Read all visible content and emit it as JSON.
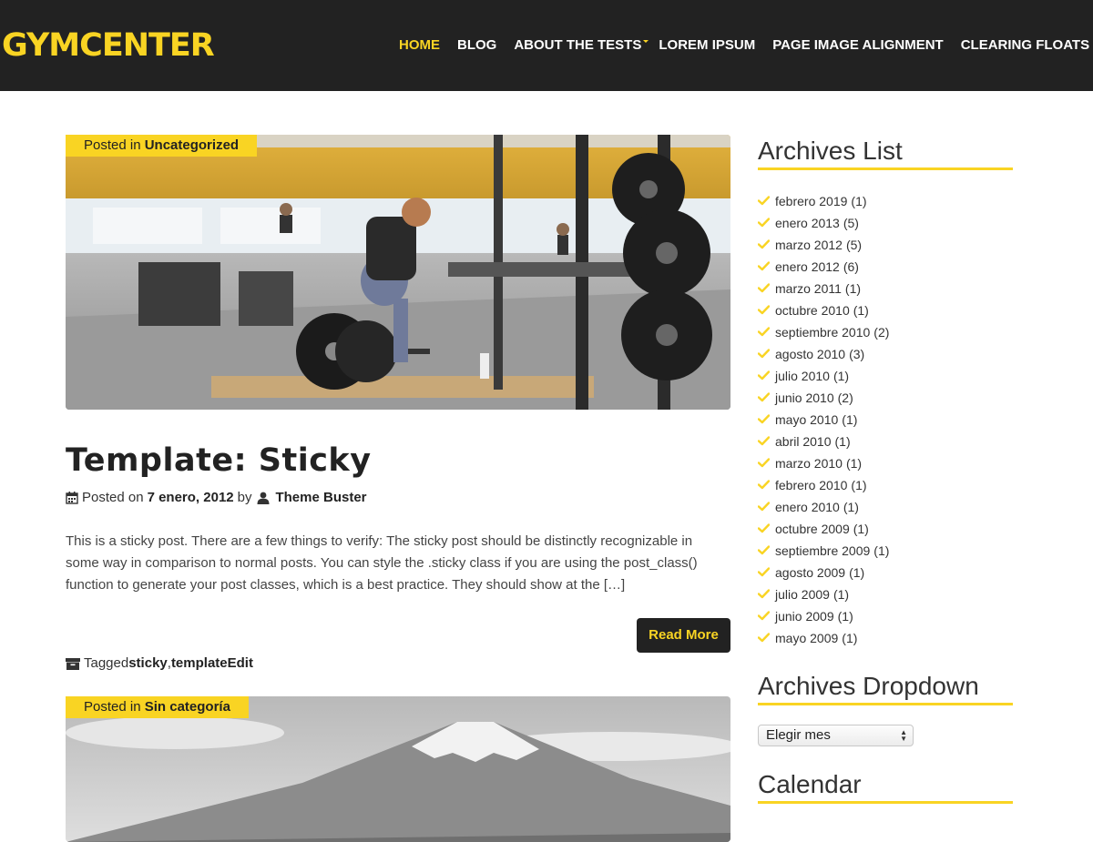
{
  "site": {
    "logo": "GYMCENTER"
  },
  "nav": {
    "items": [
      {
        "label": "HOME"
      },
      {
        "label": "BLOG"
      },
      {
        "label": "ABOUT THE TESTS"
      },
      {
        "label": "LOREM IPSUM"
      },
      {
        "label": "PAGE IMAGE ALIGNMENT"
      },
      {
        "label": "CLEARING FLOATS"
      }
    ]
  },
  "post1": {
    "posted_in_prefix": "Posted in",
    "category": "Uncategorized",
    "title": "Template: Sticky",
    "posted_on_prefix": "Posted on",
    "date": "7 enero, 2012",
    "by": "by",
    "author": "Theme Buster",
    "excerpt": "This is a sticky post. There are a few things to verify: The sticky post should be distinctly recognizable in some way in comparison to normal posts. You can style the .sticky class if you are using the post_class() function to generate your post classes, which is a best practice. They should show at the […]",
    "read_more": "Read More",
    "tagged_prefix": "Tagged",
    "tag1": "sticky",
    "tag_sep": ",",
    "tag2": "template",
    "edit": "Edit"
  },
  "post2": {
    "posted_in_prefix": "Posted in",
    "category": "Sin categoría"
  },
  "sidebar": {
    "archives_title": "Archives List",
    "archives": [
      {
        "label": "febrero 2019",
        "count": "(1)"
      },
      {
        "label": "enero 2013",
        "count": "(5)"
      },
      {
        "label": "marzo 2012",
        "count": "(5)"
      },
      {
        "label": "enero 2012",
        "count": "(6)"
      },
      {
        "label": "marzo 2011",
        "count": "(1)"
      },
      {
        "label": "octubre 2010",
        "count": "(1)"
      },
      {
        "label": "septiembre 2010",
        "count": "(2)"
      },
      {
        "label": "agosto 2010",
        "count": "(3)"
      },
      {
        "label": "julio 2010",
        "count": "(1)"
      },
      {
        "label": "junio 2010",
        "count": "(2)"
      },
      {
        "label": "mayo 2010",
        "count": "(1)"
      },
      {
        "label": "abril 2010",
        "count": "(1)"
      },
      {
        "label": "marzo 2010",
        "count": "(1)"
      },
      {
        "label": "febrero 2010",
        "count": "(1)"
      },
      {
        "label": "enero 2010",
        "count": "(1)"
      },
      {
        "label": "octubre 2009",
        "count": "(1)"
      },
      {
        "label": "septiembre 2009",
        "count": "(1)"
      },
      {
        "label": "agosto 2009",
        "count": "(1)"
      },
      {
        "label": "julio 2009",
        "count": "(1)"
      },
      {
        "label": "junio 2009",
        "count": "(1)"
      },
      {
        "label": "mayo 2009",
        "count": "(1)"
      }
    ],
    "dropdown_title": "Archives Dropdown",
    "dropdown_value": "Elegir mes",
    "calendar_title": "Calendar"
  },
  "colors": {
    "accent": "#f9d423",
    "header_bg": "#222222",
    "text": "#333333"
  }
}
